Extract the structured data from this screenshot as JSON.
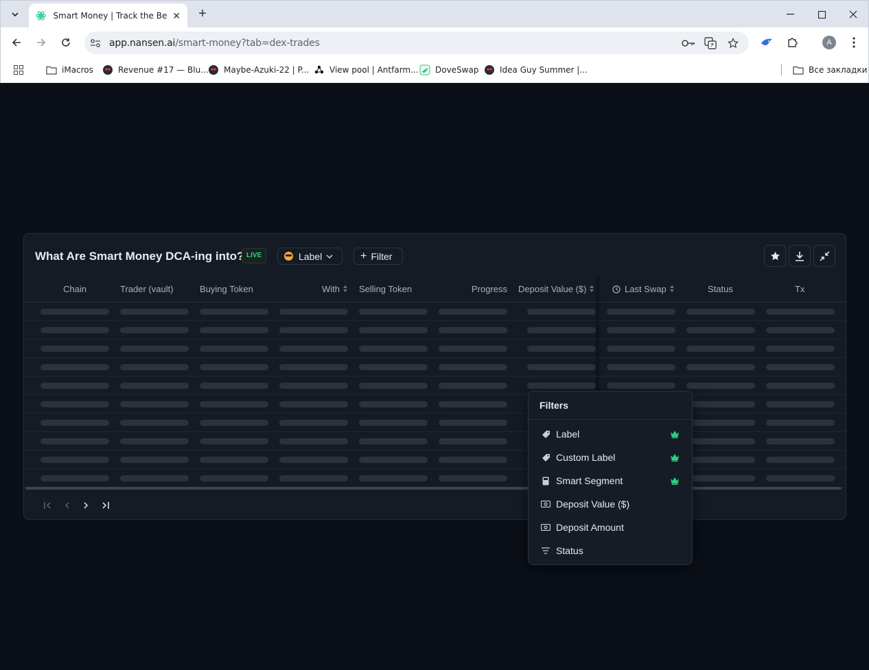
{
  "browser": {
    "tab_title": "Smart Money | Track the Best Performing Wallets",
    "url_host": "app.nansen.ai",
    "url_path": "/smart-money?tab=dex-trades",
    "bookmarks": [
      {
        "label": "iMacros",
        "icon": "folder-icon"
      },
      {
        "label": "Revenue #17 — Blu...",
        "icon": "avatar-icon"
      },
      {
        "label": "Maybe-Azuki-22 | P...",
        "icon": "avatar-icon"
      },
      {
        "label": "View pool | Antfarm...",
        "icon": "antfarm-icon"
      },
      {
        "label": "DoveSwap",
        "icon": "doveswap-icon"
      },
      {
        "label": "Idea Guy Summer |...",
        "icon": "avatar-icon"
      }
    ],
    "all_bookmarks": "Все закладки",
    "profile_initial": "A"
  },
  "card": {
    "title": "What Are Smart Money DCA-ing into?",
    "live": "LIVE",
    "label_chip": "Label",
    "filter_chip": "Filter"
  },
  "table": {
    "columns": [
      "Chain",
      "Trader (vault)",
      "Buying Token",
      "With",
      "Selling Token",
      "Progress",
      "Deposit Value ($)",
      "Last Swap",
      "Status",
      "Tx"
    ],
    "loading_rows": 10
  },
  "filters_menu": {
    "title": "Filters",
    "items": [
      {
        "label": "Label",
        "icon": "tag-icon",
        "premium": true
      },
      {
        "label": "Custom Label",
        "icon": "tag-icon",
        "premium": true
      },
      {
        "label": "Smart Segment",
        "icon": "segment-icon",
        "premium": true
      },
      {
        "label": "Deposit Value ($)",
        "icon": "money-icon",
        "premium": false
      },
      {
        "label": "Deposit Amount",
        "icon": "money-icon",
        "premium": false
      },
      {
        "label": "Status",
        "icon": "filter-lines-icon",
        "premium": false
      }
    ]
  },
  "colors": {
    "page_bg": "#0b0f17",
    "card_bg": "#151b24",
    "accent_green": "#2bd27c"
  }
}
